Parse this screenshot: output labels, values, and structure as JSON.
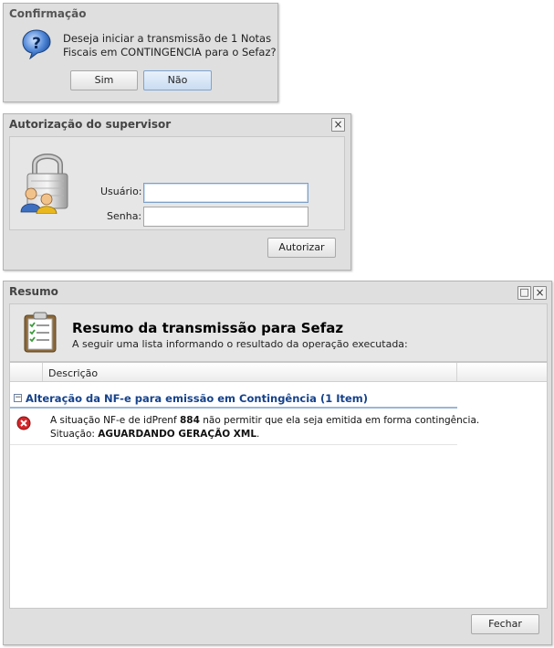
{
  "confirm": {
    "title": "Confirmação",
    "message_line1": "Deseja iniciar a transmissão de 1 Notas",
    "message_line2": "Fiscais em CONTINGENCIA para o Sefaz?",
    "yes_label": "Sim",
    "no_label": "Não"
  },
  "auth": {
    "title": "Autorização do supervisor",
    "close_glyph": "×",
    "user_label": "Usuário:",
    "user_value": "",
    "pass_label": "Senha:",
    "pass_value": "",
    "authorize_label": "Autorizar"
  },
  "summary": {
    "title": "Resumo",
    "maximize_glyph": "□",
    "close_glyph": "×",
    "heading": "Resumo da transmissão para Sefaz",
    "subheading": "A seguir uma lista informando o resultado da operação executada:",
    "column_header": "Descrição",
    "group_toggle": "−",
    "group_label": "Alteração da NF-e para emissão em Contingência (1 Item)",
    "item": {
      "line1_prefix": "A situação NF-e de idPrenf ",
      "line1_bold": "884",
      "line1_suffix": " não permitir que ela seja emitida em forma contingência.",
      "line2_prefix": "Situação: ",
      "line2_bold": "AGUARDANDO GERAÇÃO XML",
      "line2_suffix": "."
    },
    "close_label": "Fechar"
  }
}
